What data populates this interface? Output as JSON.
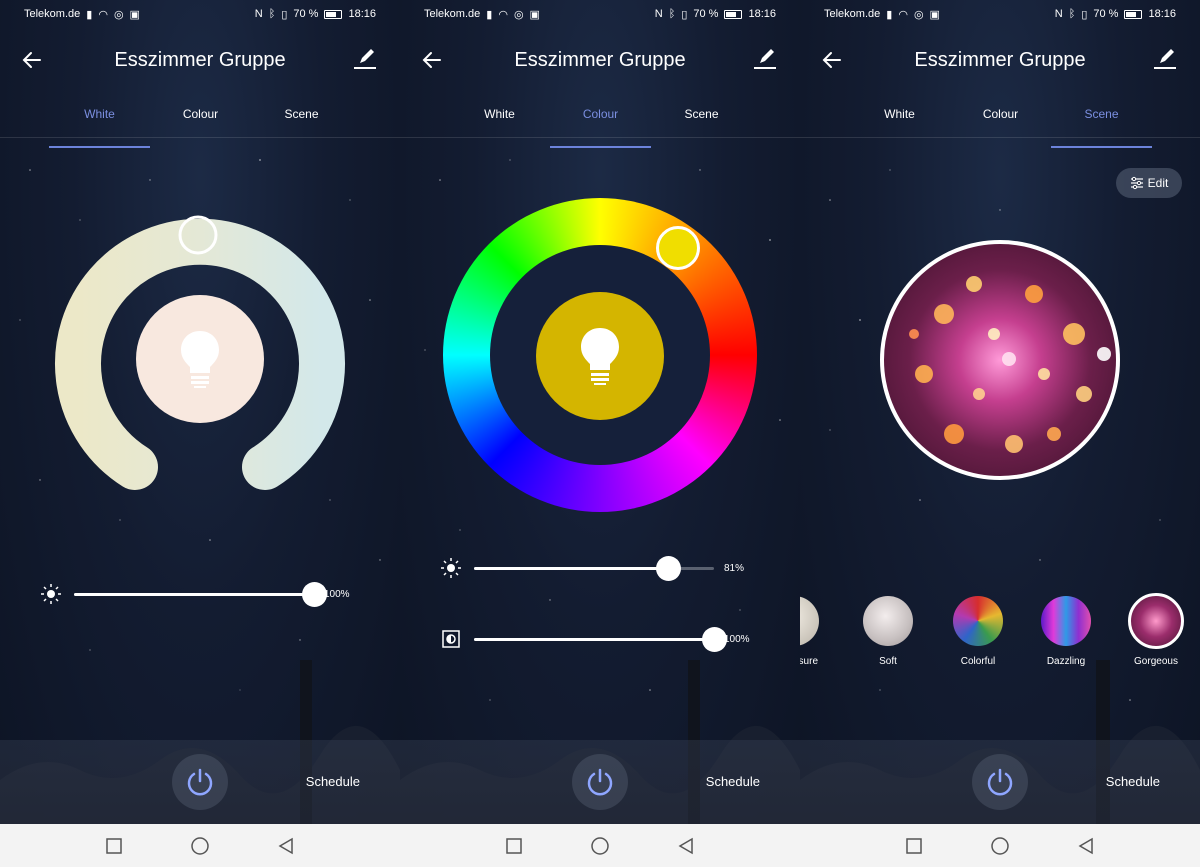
{
  "status_bar": {
    "carrier": "Telekom.de",
    "battery": "70 %",
    "time": "18:16"
  },
  "header": {
    "title": "Esszimmer Gruppe"
  },
  "tabs": [
    "White",
    "Colour",
    "Scene"
  ],
  "screens": [
    {
      "active_tab": "White",
      "brightness_value": "100%",
      "brightness_level": 1.0
    },
    {
      "active_tab": "Colour",
      "brightness_value": "81%",
      "brightness_level": 0.81,
      "saturation_value": "100%",
      "saturation_level": 1.0
    },
    {
      "active_tab": "Scene",
      "edit_label": "Edit",
      "scenes": [
        "sure",
        "Soft",
        "Colorful",
        "Dazzling",
        "Gorgeous"
      ],
      "selected_scene": "Gorgeous"
    }
  ],
  "bottom": {
    "schedule_label": "Schedule"
  },
  "colors": {
    "accent": "#7b8fe0",
    "selected_bulb_white": "#f8e8df",
    "selected_bulb_colour": "#d4b500"
  }
}
